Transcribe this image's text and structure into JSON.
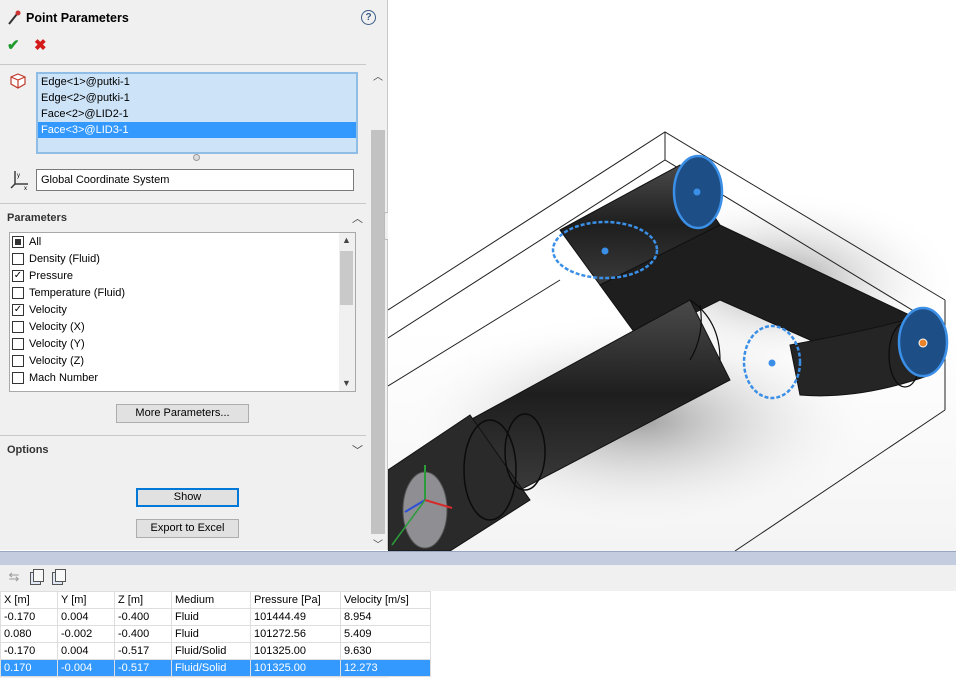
{
  "panel": {
    "title": "Point Parameters",
    "help": "?",
    "ok_glyph": "✔",
    "cancel_glyph": "✖",
    "selections": [
      "Edge<1>@putki-1",
      "Edge<2>@putki-1",
      "Face<2>@LID2-1",
      "Face<3>@LID3-1"
    ],
    "selected_index": 3,
    "coordinate_system": "Global Coordinate System",
    "parameters_title": "Parameters",
    "parameters": [
      {
        "label": "All",
        "state": "indeterminate"
      },
      {
        "label": "Density (Fluid)",
        "state": "unchecked"
      },
      {
        "label": "Pressure",
        "state": "checked"
      },
      {
        "label": "Temperature (Fluid)",
        "state": "unchecked"
      },
      {
        "label": "Velocity",
        "state": "checked"
      },
      {
        "label": "Velocity (X)",
        "state": "unchecked"
      },
      {
        "label": "Velocity (Y)",
        "state": "unchecked"
      },
      {
        "label": "Velocity (Z)",
        "state": "unchecked"
      },
      {
        "label": "Mach Number",
        "state": "unchecked"
      }
    ],
    "more_parameters": "More Parameters...",
    "options_title": "Options",
    "show": "Show",
    "export": "Export to Excel"
  },
  "results": {
    "columns": [
      "X [m]",
      "Y [m]",
      "Z [m]",
      "Medium",
      "Pressure [Pa]",
      "Velocity [m/s]"
    ],
    "rows": [
      [
        "-0.170",
        "0.004",
        "-0.400",
        "Fluid",
        "101444.49",
        "8.954"
      ],
      [
        "0.080",
        "-0.002",
        "-0.400",
        "Fluid",
        "101272.56",
        "5.409"
      ],
      [
        "-0.170",
        "0.004",
        "-0.517",
        "Fluid/Solid",
        "101325.00",
        "9.630"
      ],
      [
        "0.170",
        "-0.004",
        "-0.517",
        "Fluid/Solid",
        "101325.00",
        "12.273"
      ]
    ],
    "selected_row": 3
  },
  "toolbar": {
    "icons": [
      "refresh-icon",
      "copy-icon",
      "copy-all-icon"
    ]
  },
  "colors": {
    "selection": "#3399ff",
    "highlight": "#1f6fc4",
    "ok": "#1f9a2d",
    "cancel": "#d51a1a"
  }
}
